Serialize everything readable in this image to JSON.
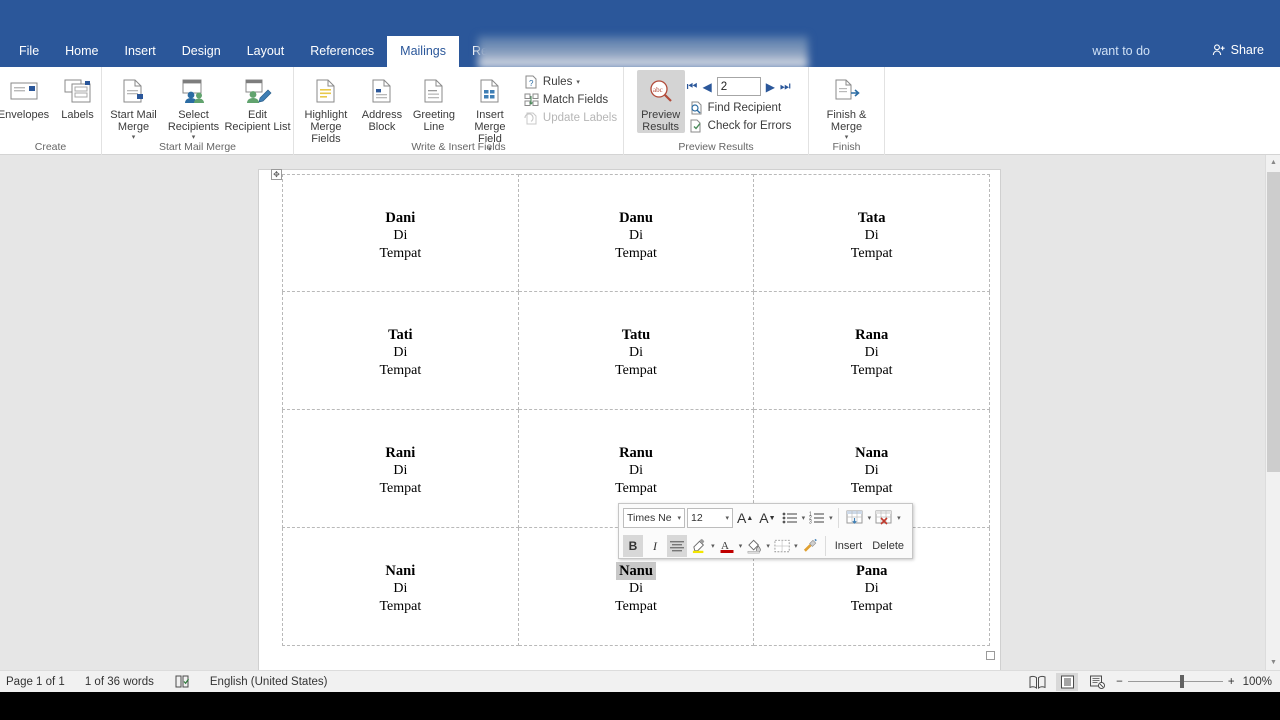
{
  "window": {
    "share_label": "Share",
    "tell_me_fragment": "want to do"
  },
  "tabs": [
    {
      "label": "File",
      "active": false
    },
    {
      "label": "Home",
      "active": false
    },
    {
      "label": "Insert",
      "active": false
    },
    {
      "label": "Design",
      "active": false
    },
    {
      "label": "Layout",
      "active": false
    },
    {
      "label": "References",
      "active": false
    },
    {
      "label": "Mailings",
      "active": true
    },
    {
      "label": "Revie",
      "active": false
    }
  ],
  "ribbon": {
    "groups": [
      {
        "name": "Create",
        "label": "Create",
        "buttons": [
          {
            "label": "Envelopes",
            "icon": "envelope-icon"
          },
          {
            "label": "Labels",
            "icon": "labels-icon"
          }
        ]
      },
      {
        "name": "Start Mail Merge",
        "label": "Start Mail Merge",
        "buttons": [
          {
            "label": "Start Mail\nMerge",
            "icon": "start-mail-merge-icon",
            "dropdown": true
          },
          {
            "label": "Select\nRecipients",
            "icon": "select-recipients-icon",
            "dropdown": true
          },
          {
            "label": "Edit\nRecipient List",
            "icon": "edit-recipient-list-icon",
            "dropdown": false
          }
        ]
      },
      {
        "name": "Write & Insert Fields",
        "label": "Write & Insert Fields",
        "buttons": [
          {
            "label": "Highlight\nMerge Fields",
            "icon": "highlight-merge-fields-icon",
            "dropdown": false
          },
          {
            "label": "Address\nBlock",
            "icon": "address-block-icon",
            "dropdown": false
          },
          {
            "label": "Greeting\nLine",
            "icon": "greeting-line-icon",
            "dropdown": false
          },
          {
            "label": "Insert Merge\nField",
            "icon": "insert-merge-field-icon",
            "dropdown": true
          }
        ],
        "small_buttons": [
          {
            "label": "Rules",
            "icon": "rules-icon",
            "dropdown": true,
            "disabled": false
          },
          {
            "label": "Match Fields",
            "icon": "match-fields-icon",
            "dropdown": false,
            "disabled": false
          },
          {
            "label": "Update Labels",
            "icon": "update-labels-icon",
            "dropdown": false,
            "disabled": true
          }
        ]
      },
      {
        "name": "Preview Results",
        "label": "Preview Results",
        "buttons": [
          {
            "label": "Preview\nResults",
            "icon": "preview-results-icon",
            "selected": true
          }
        ],
        "record_nav": {
          "first_label": "First record",
          "prev_label": "Previous record",
          "next_label": "Next record",
          "last_label": "Last record",
          "record_value": "2"
        },
        "small_buttons": [
          {
            "label": "Find Recipient",
            "icon": "find-recipient-icon"
          },
          {
            "label": "Check for Errors",
            "icon": "check-for-errors-icon"
          }
        ]
      },
      {
        "name": "Finish",
        "label": "Finish",
        "buttons": [
          {
            "label": "Finish &\nMerge",
            "icon": "finish-and-merge-icon",
            "dropdown": true
          }
        ]
      }
    ]
  },
  "document": {
    "label_rows": [
      [
        {
          "name": "Dani",
          "line2": "Di",
          "line3": "Tempat",
          "highlighted": false
        },
        {
          "name": "Danu",
          "line2": "Di",
          "line3": "Tempat",
          "highlighted": false
        },
        {
          "name": "Tata",
          "line2": "Di",
          "line3": "Tempat",
          "highlighted": false
        }
      ],
      [
        {
          "name": "Tati",
          "line2": "Di",
          "line3": "Tempat",
          "highlighted": false
        },
        {
          "name": "Tatu",
          "line2": "Di",
          "line3": "Tempat",
          "highlighted": false
        },
        {
          "name": "Rana",
          "line2": "Di",
          "line3": "Tempat",
          "highlighted": false
        }
      ],
      [
        {
          "name": "Rani",
          "line2": "Di",
          "line3": "Tempat",
          "highlighted": false
        },
        {
          "name": "Ranu",
          "line2": "Di",
          "line3": "Tempat",
          "highlighted": false
        },
        {
          "name": "Nana",
          "line2": "Di",
          "line3": "Tempat",
          "highlighted": false
        }
      ],
      [
        {
          "name": "Nani",
          "line2": "Di",
          "line3": "Tempat",
          "highlighted": false
        },
        {
          "name": "Nanu",
          "line2": "Di",
          "line3": "Tempat",
          "highlighted": true
        },
        {
          "name": "Pana",
          "line2": "Di",
          "line3": "Tempat",
          "highlighted": false
        }
      ]
    ]
  },
  "mini_toolbar": {
    "font_name": "Times Ne",
    "font_size": "12",
    "grow_font_label": "A",
    "shrink_font_label": "A",
    "bullets_label": "Bullets",
    "numbering_label": "Numbering",
    "insert_label": "Insert",
    "delete_label": "Delete",
    "bold_label": "B",
    "italic_label": "I",
    "center_label": "Center",
    "highlight_color": "#f3e600",
    "font_color": "#c00000",
    "shading_label": "Shading",
    "borders_label": "Borders",
    "format_painter_label": "Format Painter"
  },
  "status_bar": {
    "page": "Page 1 of 1",
    "words": "1 of 36 words",
    "proofing_icon": "proofing-errors-icon",
    "language": "English (United States)",
    "views": [
      {
        "name": "read-mode-view",
        "active": false
      },
      {
        "name": "print-layout-view",
        "active": true
      },
      {
        "name": "web-layout-view",
        "active": false
      }
    ],
    "zoom_out": "−",
    "zoom_in": "+",
    "zoom_level": "100%"
  },
  "colors": {
    "ribbon_blue": "#2b579a",
    "doc_background": "#e6e6e6",
    "selection_gray": "#c8c8c8"
  }
}
